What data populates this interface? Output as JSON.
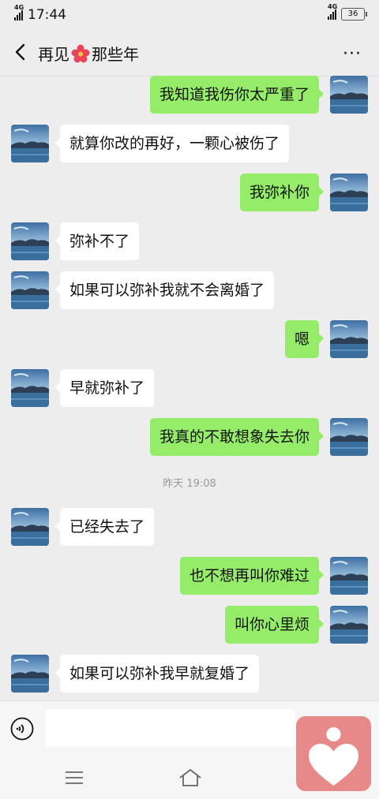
{
  "status_bar": {
    "network": "4G",
    "time": "17:44",
    "network_right": "4G",
    "battery": "36"
  },
  "header": {
    "title_before": "再见",
    "title_after": "那些年",
    "more": "···"
  },
  "messages": [
    {
      "side": "right",
      "text": "我知道我伤你太严重了"
    },
    {
      "side": "left",
      "text": "就算你改的再好，一颗心被伤了"
    },
    {
      "side": "right",
      "text": "我弥补你"
    },
    {
      "side": "left",
      "text": "弥补不了"
    },
    {
      "side": "left",
      "text": "如果可以弥补我就不会离婚了"
    },
    {
      "side": "right",
      "text": "嗯"
    },
    {
      "side": "left",
      "text": "早就弥补了"
    },
    {
      "side": "right",
      "text": "我真的不敢想象失去你"
    },
    {
      "side": "left",
      "text": "已经失去了"
    },
    {
      "side": "right",
      "text": "也不想再叫你难过"
    },
    {
      "side": "right",
      "text": "叫你心里烦"
    },
    {
      "side": "left",
      "text": "如果可以弥补我早就复婚了"
    }
  ],
  "timestamp": "昨天 19:08",
  "input": {
    "value": "",
    "placeholder": ""
  },
  "colors": {
    "sent_bubble": "#95ec69",
    "received_bubble": "#ffffff",
    "background": "#ededed",
    "heart_app": "#e88989"
  }
}
